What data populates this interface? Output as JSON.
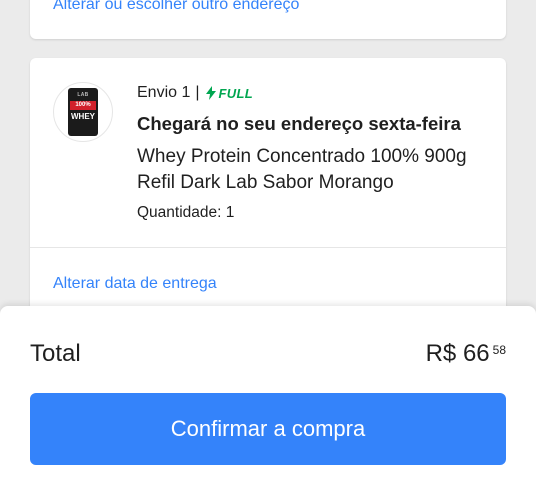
{
  "top_card": {
    "link": "Alterar ou escolher outro endereço"
  },
  "shipment": {
    "label": "Envio 1",
    "separator": "|",
    "badge": "FULL",
    "badge_color": "#00a650",
    "arrival": "Chegará no seu endereço sexta-feira",
    "product_title": "Whey Protein Concentrado 100% 900g Refil Dark Lab Sabor Morango",
    "quantity": "Quantidade: 1",
    "change_date": "Alterar data de entrega",
    "thumbnail": {
      "brand": "LAB",
      "tag": "100%",
      "name": "WHEY"
    }
  },
  "summary": {
    "total_label": "Total",
    "total_value": "R$ 66",
    "total_cents": "58",
    "confirm_label": "Confirmar a compra",
    "accent_color": "#3483fa"
  }
}
